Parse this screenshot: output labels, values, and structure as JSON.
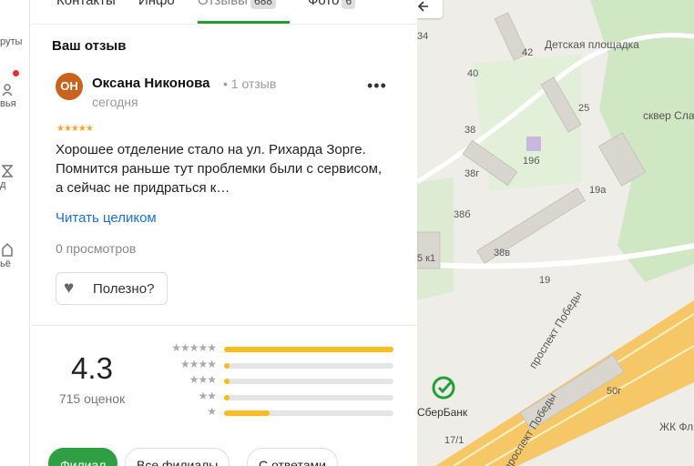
{
  "sidebar": {
    "items": [
      {
        "label": "руты",
        "icon": "route-icon"
      },
      {
        "label": "вья",
        "icon": "user-icon"
      },
      {
        "label": "д",
        "icon": "hourglass-icon"
      },
      {
        "label": "ьё",
        "icon": "home-icon"
      }
    ]
  },
  "tabs": {
    "contacts": "Контакты",
    "info": "Инфо",
    "reviews": "Отзывы",
    "reviews_count": "688",
    "photos": "Фото",
    "photos_count": "6"
  },
  "review": {
    "section_title": "Ваш отзыв",
    "avatar_initials": "ОН",
    "author": "Оксана Никонова",
    "author_reviews": "1 отзыв",
    "date": "сегодня",
    "stars": 5,
    "text": "Хорошее отделение стало на ул. Рихарда Зорге. Помнится раньше тут проблемки были с сервисом, а сейчас не придраться к…",
    "read_more": "Читать целиком",
    "views": "0 просмотров",
    "useful_label": "Полезно?"
  },
  "rating": {
    "value": "4.3",
    "count_label": "715 оценок",
    "distribution": [
      {
        "stars": 5,
        "fraction": 1.0
      },
      {
        "stars": 4,
        "fraction": 0.03
      },
      {
        "stars": 3,
        "fraction": 0.03
      },
      {
        "stars": 2,
        "fraction": 0.03
      },
      {
        "stars": 1,
        "fraction": 0.27
      }
    ]
  },
  "filters": {
    "branch": "Филиал",
    "all_branches": "Все филиалы",
    "with_answers": "С ответами"
  },
  "map": {
    "labels": {
      "n34": "34",
      "n42": "42",
      "n40": "40",
      "n38": "38",
      "n25": "25",
      "n19b": "19б",
      "n38g": "38г",
      "n38b": "38б",
      "n38v": "38в",
      "n19a": "19а",
      "n19": "19",
      "n5k1": "5 к1",
      "n50g": "50г",
      "n17_1": "17/1"
    },
    "playground": "Детская площадка",
    "square": "сквер Сла",
    "avenue_1": "проспект Победы",
    "avenue_2": "проспект Победы",
    "bank": "СберБанк",
    "zhk": "ЖК Фл"
  },
  "colors": {
    "accent_green": "#2ea043",
    "star": "#f5a623",
    "bar_fill": "#fbbc1e",
    "link": "#1b6fd6",
    "avatar": "#c8621c"
  }
}
